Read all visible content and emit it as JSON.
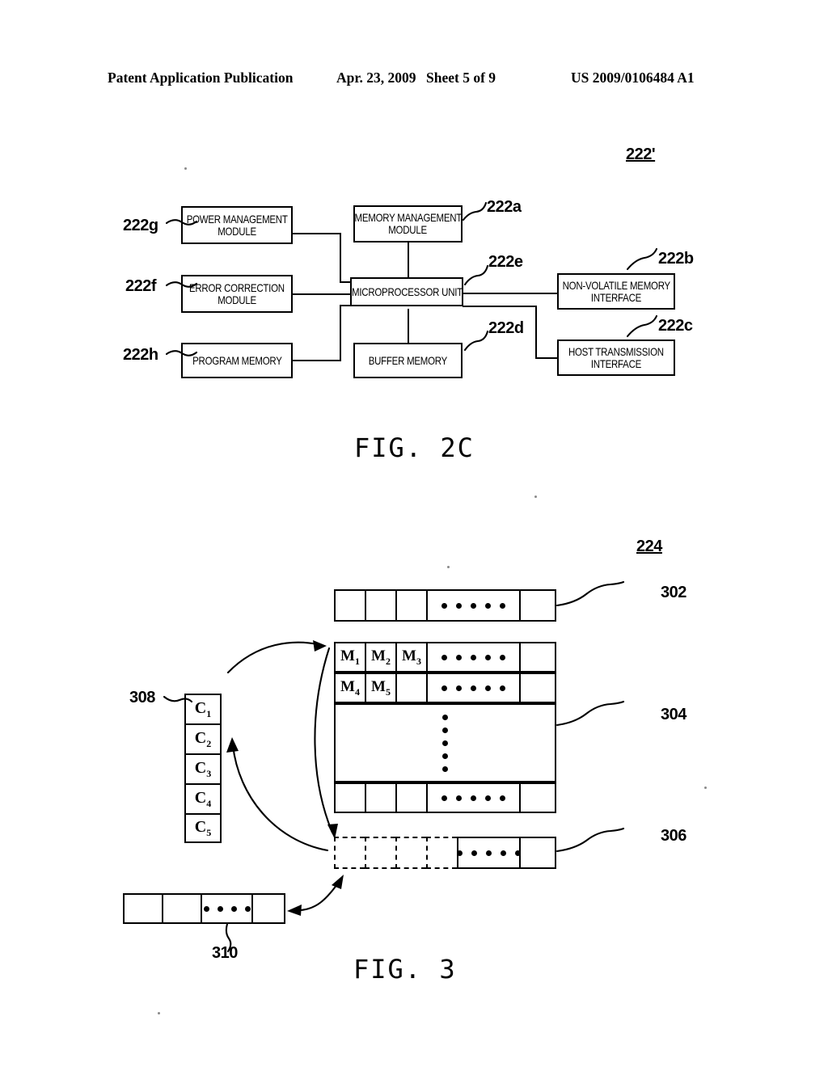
{
  "header": {
    "publication": "Patent Application Publication",
    "date": "Apr. 23, 2009",
    "sheet": "Sheet 5 of 9",
    "number": "US 2009/0106484 A1"
  },
  "fig2c": {
    "caption": "FIG. 2C",
    "assembly_ref": "222'",
    "blocks": [
      {
        "ref": "222g",
        "line1": "POWER MANAGEMENT",
        "line2": "MODULE"
      },
      {
        "ref": "222f",
        "line1": "ERROR CORRECTION",
        "line2": "MODULE"
      },
      {
        "ref": "222h",
        "line1": "PROGRAM MEMORY",
        "line2": ""
      },
      {
        "ref": "222a",
        "line1": "MEMORY MANAGEMENT",
        "line2": "MODULE"
      },
      {
        "ref": "222e",
        "line1": "MICROPROCESSOR UNIT",
        "line2": ""
      },
      {
        "ref": "222d",
        "line1": "BUFFER MEMORY",
        "line2": ""
      },
      {
        "ref": "222b",
        "line1": "NON-VOLATILE MEMORY",
        "line2": "INTERFACE"
      },
      {
        "ref": "222c",
        "line1": "HOST TRANSMISSION",
        "line2": "INTERFACE"
      }
    ]
  },
  "fig3": {
    "caption": "FIG. 3",
    "assembly_ref": "224",
    "refs": {
      "row302": "302",
      "table304": "304",
      "row306": "306",
      "column308": "308",
      "row310": "310"
    },
    "row302": {
      "cells": [
        "",
        "",
        "",
        "dots5",
        ""
      ]
    },
    "table304": {
      "row1": [
        "M1",
        "M2",
        "M3",
        "dots5",
        ""
      ],
      "row2": [
        "M4",
        "M5",
        "",
        "dots5",
        ""
      ],
      "middle": "vdots5",
      "row4": [
        "",
        "",
        "",
        "dots5",
        ""
      ]
    },
    "row306": {
      "cells": [
        "",
        "",
        "",
        "",
        "dots5",
        ""
      ]
    },
    "column308": {
      "cells": [
        "C1",
        "C2",
        "C3",
        "C4",
        "C5"
      ]
    },
    "row310": {
      "cells": [
        "",
        "",
        "dots4",
        ""
      ]
    },
    "labels": {
      "M1": "M",
      "M1sub": "1",
      "M2": "M",
      "M2sub": "2",
      "M3": "M",
      "M3sub": "3",
      "M4": "M",
      "M4sub": "4",
      "M5": "M",
      "M5sub": "5",
      "C1": "C",
      "C1sub": "1",
      "C2": "C",
      "C2sub": "2",
      "C3": "C",
      "C3sub": "3",
      "C4": "C",
      "C4sub": "4",
      "C5": "C",
      "C5sub": "5"
    }
  }
}
